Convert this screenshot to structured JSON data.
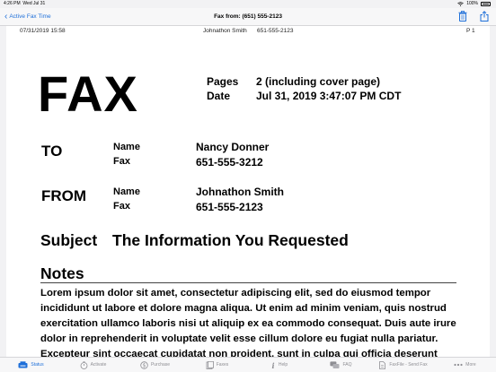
{
  "status_bar": {
    "time": "4:26 PM",
    "date": "Wed Jul 31",
    "battery": "100%"
  },
  "nav": {
    "back_label": "Active Fax Time",
    "title": "Fax from: (651) 555-2123",
    "trash_icon": "trash-icon",
    "share_icon": "share-icon"
  },
  "doc": {
    "header": {
      "datetime": "07/31/2019 15:58",
      "name": "Johnathon Smith",
      "number": "651-555-2123",
      "page": "P 1"
    },
    "fax_label": "FAX",
    "pages_label": "Pages",
    "pages_value": "2 (including cover page)",
    "date_label": "Date",
    "date_value": "Jul 31, 2019 3:47:07 PM CDT",
    "to": {
      "heading": "TO",
      "name_label": "Name",
      "name": "Nancy Donner",
      "fax_label": "Fax",
      "fax": "651-555-3212"
    },
    "from": {
      "heading": "FROM",
      "name_label": "Name",
      "name": "Johnathon Smith",
      "fax_label": "Fax",
      "fax": "651-555-2123"
    },
    "subject_label": "Subject",
    "subject": "The Information You Requested",
    "notes_label": "Notes",
    "notes_text": "Lorem ipsum dolor sit amet, consectetur adipiscing elit, sed do eiusmod tempor incididunt ut labore et dolore magna aliqua. Ut enim ad minim veniam, quis nostrud exercitation ullamco laboris nisi ut aliquip ex ea commodo consequat. Duis aute irure dolor in reprehenderit in voluptate velit esse cillum dolore eu fugiat nulla pariatur. Excepteur sint occaecat cupidatat non proident, sunt in culpa qui officia deserunt mollit anim id est laborum."
  },
  "tabs": [
    {
      "label": "Status",
      "icon": "status-icon"
    },
    {
      "label": "Activate",
      "icon": "stopwatch-icon"
    },
    {
      "label": "Purchase",
      "icon": "dollar-icon"
    },
    {
      "label": "Faxes",
      "icon": "faxes-icon"
    },
    {
      "label": "Help",
      "icon": "info-icon"
    },
    {
      "label": "FAQ",
      "icon": "chat-icon"
    },
    {
      "label": "FaxFile - Send Fax",
      "icon": "send-fax-icon"
    },
    {
      "label": "More",
      "icon": "more-icon"
    }
  ],
  "colors": {
    "accent": "#1e6fd9",
    "inactive": "#8e8e93"
  }
}
